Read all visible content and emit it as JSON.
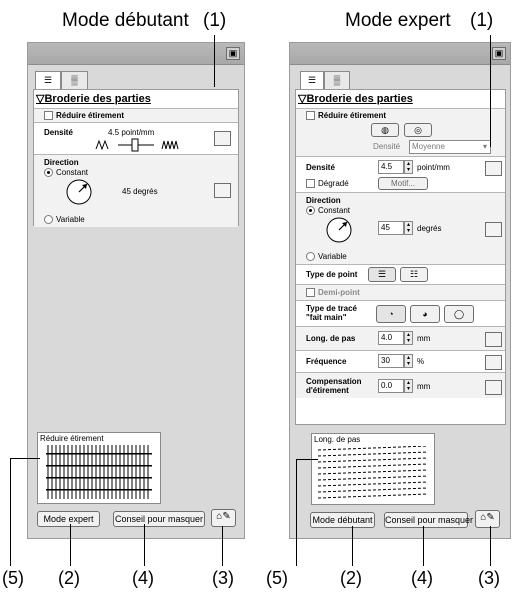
{
  "captions": {
    "left": "Mode débutant",
    "right": "Mode expert"
  },
  "callouts": {
    "c1": "(1)",
    "c2": "(2)",
    "c3": "(3)",
    "c4": "(4)",
    "c5": "(5)"
  },
  "left_panel": {
    "section_title": "Broderie des parties",
    "reduce_stretch_label": "Réduire étirement",
    "density_label": "Densité",
    "density_value": "4.5 point/mm",
    "direction_label": "Direction",
    "constant_label": "Constant",
    "angle_value": "45 degrés",
    "variable_label": "Variable",
    "preview_label": "Réduire étirement",
    "mode_button": "Mode expert",
    "hint_button": "Conseil pour masquer"
  },
  "right_panel": {
    "section_title": "Broderie des parties",
    "reduce_stretch_label": "Réduire étirement",
    "density_sub_label": "Densité",
    "density_select_value": "Moyenne",
    "density_label": "Densité",
    "density_value": "4.5",
    "density_unit": "point/mm",
    "gradient_label": "Dégradé",
    "pattern_button": "Motif...",
    "direction_label": "Direction",
    "constant_label": "Constant",
    "angle_value": "45",
    "angle_unit": "degrés",
    "variable_label": "Variable",
    "stitch_type_label": "Type de point",
    "half_stitch_label": "Demi-point",
    "hand_trace_label_1": "Type de tracé",
    "hand_trace_label_2": "\"fait main\"",
    "step_length_label": "Long. de pas",
    "step_length_value": "4.0",
    "step_length_unit": "mm",
    "frequency_label": "Fréquence",
    "frequency_value": "30",
    "frequency_unit": "%",
    "compensation_label_1": "Compensation",
    "compensation_label_2": "d'étirement",
    "compensation_value": "0.0",
    "compensation_unit": "mm",
    "preview_label": "Long. de pas",
    "mode_button": "Mode débutant",
    "hint_button": "Conseil pour masquer"
  }
}
